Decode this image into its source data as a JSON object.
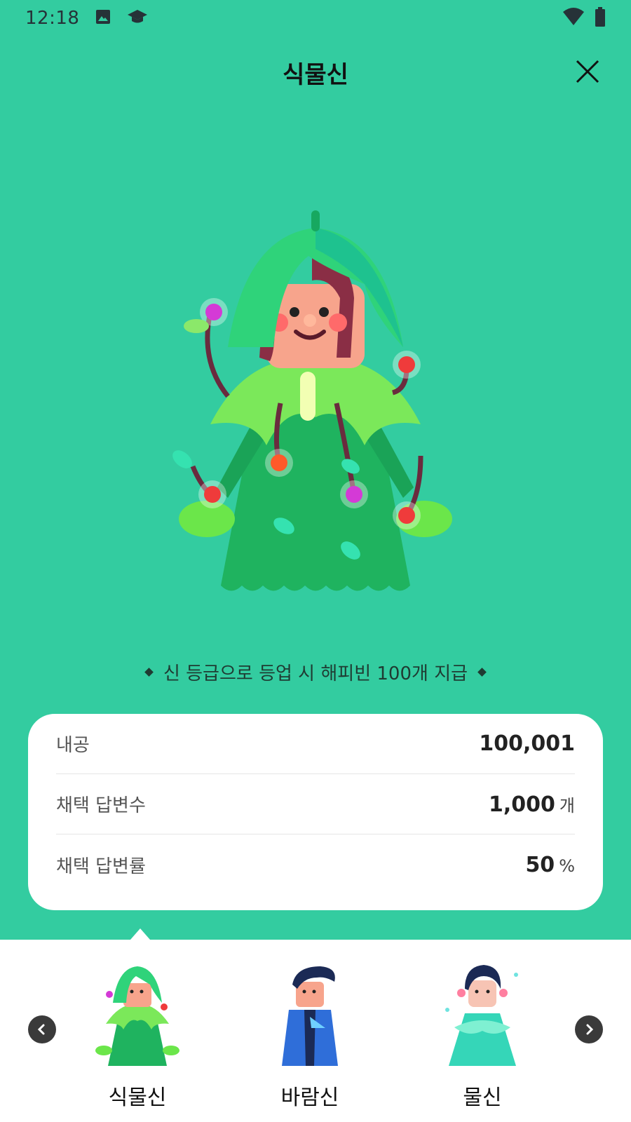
{
  "status_bar": {
    "time": "12:18",
    "icons": [
      "image-icon",
      "graduation-cap-icon",
      "wifi-icon",
      "battery-icon"
    ]
  },
  "header": {
    "title": "식물신",
    "close_icon": "close-icon"
  },
  "bonus_text": "신 등급으로 등업 시 해피빈 100개 지급",
  "stats": [
    {
      "label": "내공",
      "value": "100,001",
      "unit": ""
    },
    {
      "label": "채택 답변수",
      "value": "1,000",
      "unit": "개"
    },
    {
      "label": "채택 답변률",
      "value": "50",
      "unit": "%"
    }
  ],
  "characters": [
    {
      "label": "식물신",
      "selected": true
    },
    {
      "label": "바람신",
      "selected": false
    },
    {
      "label": "물신",
      "selected": false
    }
  ],
  "colors": {
    "background_green": "#33CCA0",
    "card_white": "#FFFFFF",
    "nav_button": "#3A3A3A"
  }
}
